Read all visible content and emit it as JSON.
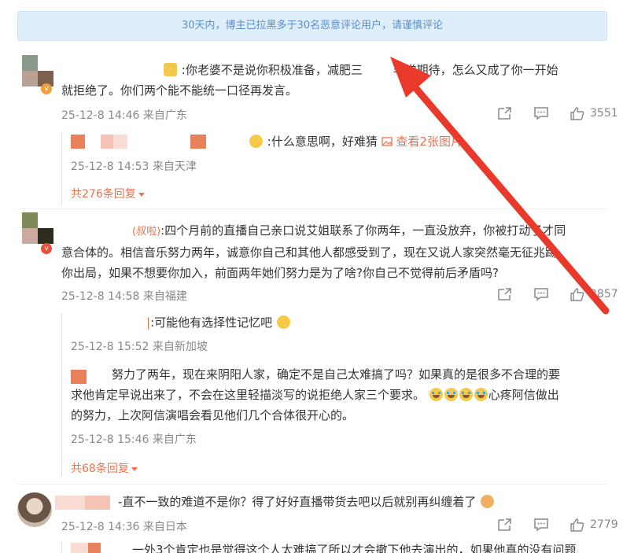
{
  "notice": {
    "text": "30天内，博主已拉黑多于30名恶意评论用户，请谨慎评论"
  },
  "comments": [
    {
      "text_line1": ":你老婆不是说你积极准备，减肥三",
      "text_line1_tail": "非常期待，怎么又成了你一开始",
      "text_line2": "就拒绝了。你们两个能不能统一口径再发言。",
      "time": "25-12-8 14:46",
      "location": "来自广东",
      "likes": "3551"
    },
    {
      "text_line1": "四个月前的直播自己亲口说艾姐联系了你两年，一直没放弃，你被打动了才同",
      "text_line1_prefix": "(叔啦)",
      "text_line2": "意合体的。相信音乐努力两年，诚意你自己和其他人都感受到了，现在又说人家突然毫无征兆踢",
      "text_line3": "你出局，如果不想要你加入，前面两年她们努力是为了啥?你自己不觉得前后矛盾吗?",
      "time": "25-12-8 14:58",
      "location": "来自福建",
      "likes": "2857"
    },
    {
      "text": "-直不一致的难道不是你？得了好好直播带货去吧以后就别再纠缠着了",
      "time": "25-12-8 14:36",
      "location": "来自日本",
      "likes": "2779",
      "next_preview": "一外3个肯定也是觉得这个人太难搞了所以才会撤下他去演出的，如果他真的没有问题"
    }
  ],
  "replies": [
    {
      "text": ":什么意思啊，好难猜",
      "pic_link": "查看2张图片",
      "time": "25-12-8 14:53",
      "location": "来自天津"
    },
    {
      "text": ":可能他有选择性记忆吧",
      "time": "25-12-8 15:52",
      "location": "来自新加坡"
    },
    {
      "text_line1": "努力了两年，现在来阴阳人家，确定不是自己太难搞了吗？如果真的是很多不合理的要",
      "text_line2": "求他肯定早说出来了，不会在这里轻描淡写的说拒绝人家三个要求。",
      "text_line2_tail": "心疼阿信做出",
      "text_line3": "的努力，上次阿信演唱会看见他们几个合体很开心的。",
      "time": "25-12-8 15:46",
      "location": "来自广东"
    }
  ],
  "more_replies": [
    "共276条回复",
    "共68条回复"
  ],
  "colors": {
    "accent": "#eb7350",
    "notice_bg": "#dfeefb",
    "notice_text": "#5b8fc9",
    "meta": "#888888",
    "arrow": "#e8392b"
  }
}
